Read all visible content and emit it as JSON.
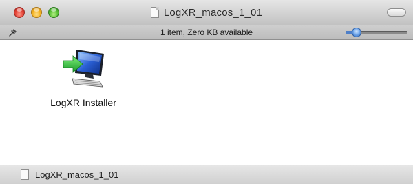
{
  "window": {
    "title": "LogXR_macos_1_01"
  },
  "statusbar": {
    "text": "1 item, Zero KB available",
    "icon_size_level": 0.18
  },
  "items": [
    {
      "label": "LogXR Installer",
      "icon": "installer-monitor-icon"
    }
  ],
  "pathbar": {
    "label": "LogXR_macos_1_01"
  },
  "colors": {
    "close": "#e5463a",
    "minimize": "#f4b324",
    "zoom": "#5fc43a",
    "slider_accent": "#4d7fc9",
    "icon_arrow": "#2fbf3c",
    "icon_screen": "#2a5fd4"
  }
}
